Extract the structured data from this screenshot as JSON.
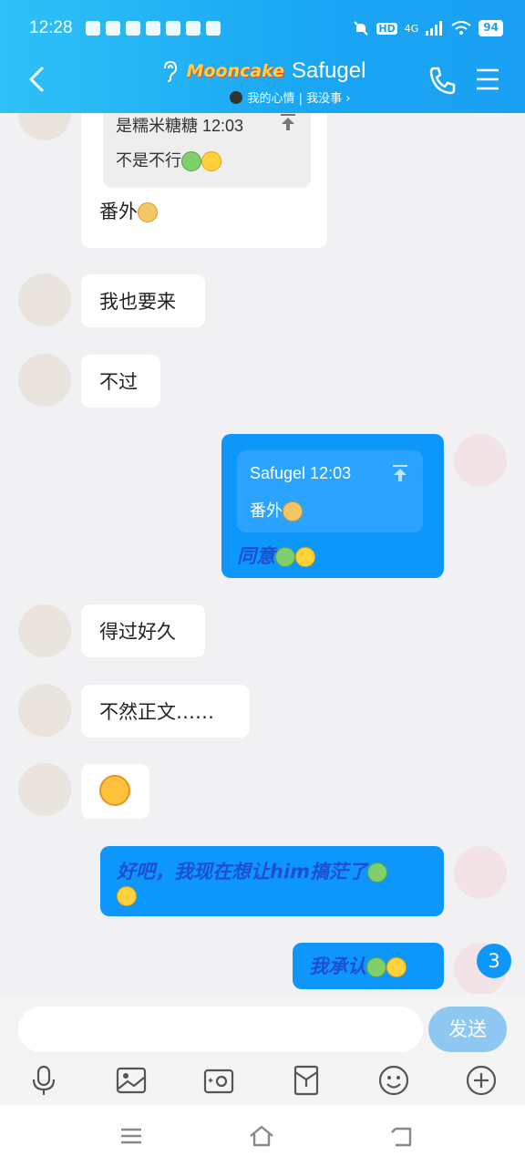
{
  "status_bar": {
    "time": "12:28",
    "network": "4G",
    "hd": "HD",
    "battery": "94"
  },
  "header": {
    "brand_badge": "Mooncake",
    "contact_name": "Safugel",
    "mood_text": "我的心情 | 我没事 ›"
  },
  "messages": [
    {
      "side": "left",
      "quote_author": "是糯米糖糖 12:03",
      "quote_text": "不是不行",
      "text": "番外"
    },
    {
      "side": "left",
      "text": "我也要来"
    },
    {
      "side": "left",
      "text": "不过"
    },
    {
      "side": "right",
      "quote_author": "Safugel 12:03",
      "quote_text": "番外",
      "text": "同意"
    },
    {
      "side": "left",
      "text": "得过好久"
    },
    {
      "side": "left",
      "text": "不然正文……"
    },
    {
      "side": "left",
      "emoji": "facepalm-emoji"
    },
    {
      "side": "right",
      "text": "好吧，我现在想让him搞茫了"
    },
    {
      "side": "right",
      "text": "我承认"
    }
  ],
  "unread_badge": "3",
  "input": {
    "send_label": "发送"
  },
  "colors": {
    "header": "#1aa6f4",
    "bubble_right": "#0d97fb",
    "bubble_left": "#ffffff",
    "italic_text": "#1e4fd0"
  }
}
